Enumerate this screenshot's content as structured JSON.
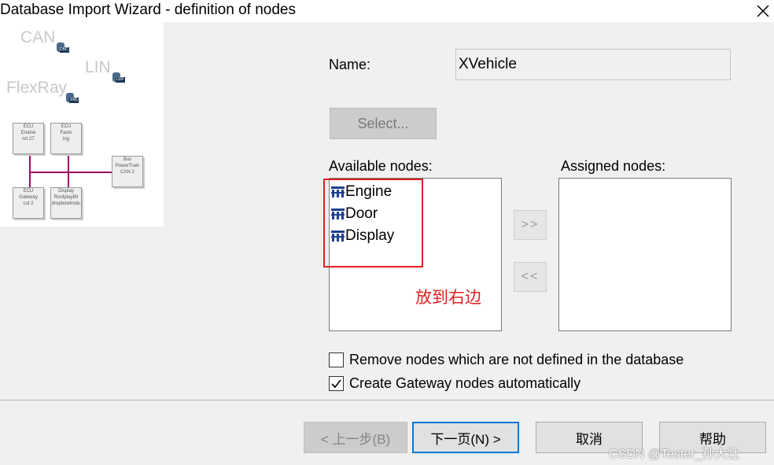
{
  "window": {
    "title": "Database Import Wizard - definition of nodes"
  },
  "illustration": {
    "bus_labels": [
      "CAN",
      "LIN",
      "FlexRay"
    ],
    "db_badges": [
      "DBC",
      "LDF",
      "XML"
    ],
    "ecus": [
      {
        "line1": "ECU",
        "line2": "Enaine",
        "line3": "nrt 27"
      },
      {
        "line1": "ECU",
        "line2": "Fasto",
        "line3": "ing"
      },
      {
        "line1": "Bus",
        "line2": "PowerTrain",
        "line3": "CAN 2"
      },
      {
        "line1": "ECU",
        "line2": "Gateway",
        "line3": "cut 2"
      },
      {
        "line1": "Display",
        "line2": "RoofplayBit",
        "line3": "dropbowtrodu"
      }
    ]
  },
  "form": {
    "name_label": "Name:",
    "name_value": "XVehicle",
    "select_label": "Select..."
  },
  "available": {
    "label": "Available nodes:",
    "items": [
      "Engine",
      "Door",
      "Display"
    ]
  },
  "assigned": {
    "label": "Assigned nodes:",
    "items": []
  },
  "move_buttons": {
    "add": ">>",
    "remove": "<<"
  },
  "annotation": {
    "text": "放到右边",
    "color": "#e02020"
  },
  "options": [
    {
      "label": "Remove nodes which are not defined in the database",
      "checked": false
    },
    {
      "label": "Create Gateway nodes automatically",
      "checked": true
    }
  ],
  "buttons": {
    "back": "< 上一步(B)",
    "next": "下一页(N) >",
    "cancel": "取消",
    "help": "帮助"
  },
  "watermark": "CSDN @Tester_孙大壮",
  "colors": {
    "focus": "#0078d7",
    "bus_line": "#a01060",
    "highlight": "#e02020"
  }
}
